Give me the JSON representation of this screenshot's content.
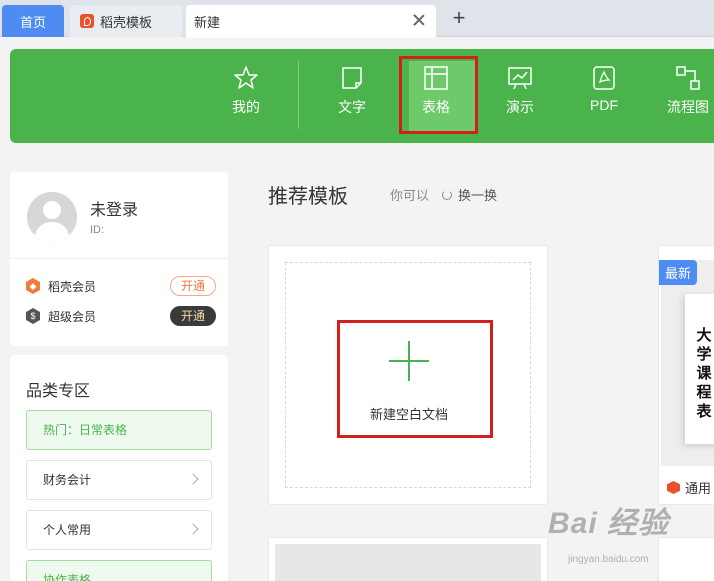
{
  "tabs": {
    "home": "首页",
    "docer": "稻壳模板",
    "new": "新建"
  },
  "header": {
    "items": [
      {
        "label": "我的",
        "icon": "star-icon"
      },
      {
        "label": "文字",
        "icon": "document-icon"
      },
      {
        "label": "表格",
        "icon": "table-icon"
      },
      {
        "label": "演示",
        "icon": "presentation-icon"
      },
      {
        "label": "PDF",
        "icon": "pdf-icon"
      },
      {
        "label": "流程图",
        "icon": "flowchart-icon"
      }
    ],
    "active": "表格",
    "colors": {
      "bg": "#4bb34b",
      "active": "#6ec96b",
      "highlight": "#d3201e"
    }
  },
  "user": {
    "name": "未登录",
    "id_label": "ID:",
    "memberships": [
      {
        "label": "稻壳会员",
        "button": "开通",
        "color": "#f07b3f"
      },
      {
        "label": "超级会员",
        "button": "开通",
        "color": "#3a3a3a"
      }
    ]
  },
  "categories": {
    "title": "品类专区",
    "items": [
      "热门：日常表格",
      "财务会计",
      "个人常用",
      "协作表格"
    ]
  },
  "main": {
    "title": "推荐模板",
    "subtitle": "你可以",
    "refresh": "换一换",
    "blank_label": "新建空白文档",
    "template": {
      "badge": "最新",
      "thumb_text": "大学课程表",
      "footer": "通用"
    }
  },
  "watermark": {
    "text": "Bai 经验",
    "url": "jingyan.baidu.com"
  }
}
